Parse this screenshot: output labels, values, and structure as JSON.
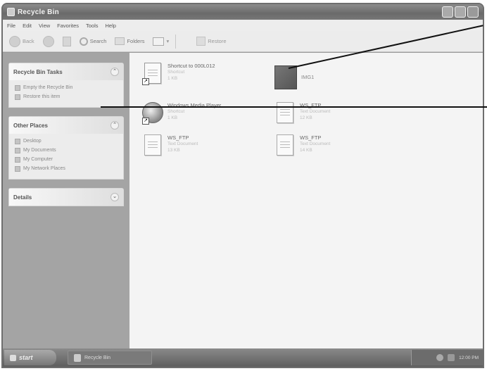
{
  "window": {
    "title": "Recycle Bin"
  },
  "menu": [
    "File",
    "Edit",
    "View",
    "Favorites",
    "Tools",
    "Help"
  ],
  "toolbar": {
    "back": "Back",
    "search": "Search",
    "folders": "Folders",
    "restore": "Restore"
  },
  "sidebar": {
    "tasks": {
      "title": "Recycle Bin Tasks",
      "items": [
        "Empty the Recycle Bin",
        "Restore this item"
      ]
    },
    "other_places": {
      "title": "Other Places",
      "items": [
        "Desktop",
        "My Documents",
        "My Computer",
        "My Network Places"
      ]
    },
    "details": {
      "title": "Details"
    }
  },
  "files": [
    {
      "name": "Shortcut to 000L012",
      "type": "Shortcut",
      "size": "1 KB"
    },
    {
      "name": "IMG1",
      "type": "",
      "size": ""
    },
    {
      "name": "Windows Media Player",
      "type": "Shortcut",
      "size": "1 KB"
    },
    {
      "name": "WS_FTP",
      "type": "Text Document",
      "size": "12 KB"
    },
    {
      "name": "WS_FTP",
      "type": "Text Document",
      "size": "13 KB"
    },
    {
      "name": "WS_FTP",
      "type": "Text Document",
      "size": "14 KB"
    }
  ],
  "taskbar": {
    "start": "start",
    "task": "Recycle Bin",
    "clock": "12:00 PM"
  },
  "colors": {
    "titlebar": "#6a6a6a",
    "content_bg": "#f4f4f4",
    "sidebar_bg": "#a4a4a4",
    "callout": "#111111"
  }
}
